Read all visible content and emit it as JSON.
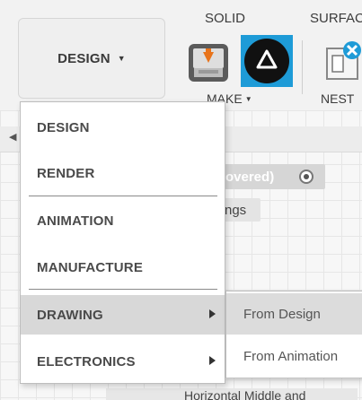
{
  "toolbar": {
    "workspace_label": "DESIGN",
    "tabs": {
      "solid": "SOLID",
      "surface": "SURFAC"
    },
    "make_label": "MAKE",
    "nest_label": "NEST",
    "icons": [
      "3d-print-icon",
      "delta-app-icon",
      "nest-arrange-icon"
    ]
  },
  "workspace_menu": {
    "items": [
      {
        "label": "DESIGN"
      },
      {
        "label": "RENDER"
      },
      {
        "label": "ANIMATION"
      },
      {
        "label": "MANUFACTURE"
      },
      {
        "label": "DRAWING"
      },
      {
        "label": "ELECTRONICS"
      }
    ]
  },
  "drawing_submenu": {
    "items": [
      {
        "label": "From Design"
      },
      {
        "label": "From Animation"
      }
    ]
  },
  "background": {
    "row_text": "overed)",
    "row2_text": "ngs",
    "bottom_text": "Horizontal Middle and"
  },
  "colors": {
    "accent_blue": "#1e9bd7",
    "menu_highlight": "#d8d8d8"
  }
}
